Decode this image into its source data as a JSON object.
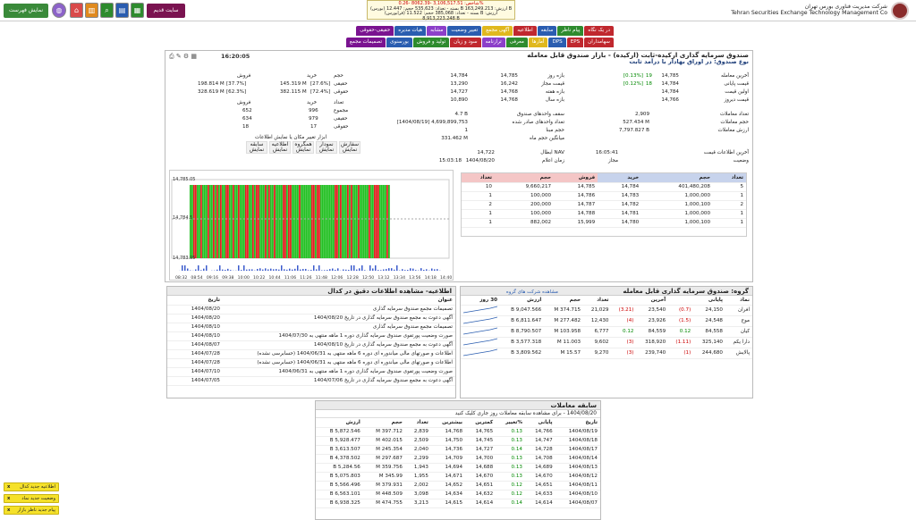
{
  "header": {
    "org_name_fa": "شرکت مدیریت فناوری بورس تهران",
    "org_name_en": "Tehran Securities Exchange Technology Management Co",
    "site_button": "سایت قدیم",
    "notice_button": "نمایش فهرست",
    "ticker": [
      "شاخص: 3,106,517.51 -8062.39 -0.26%",
      "(بورس) بسته - تعداد: 535,623 حجم: 12.447 B ارزش: 163,249.213 B",
      "(فرابورس) بسته - تعداد: 385,068 حجم: 11.522 B ارزش: 8,913,223.248 B"
    ]
  },
  "tabs_row1": [
    "در یک نگاه",
    "پیام ناظر",
    "سابقه",
    "اطلاعیه",
    "آگهی مجمع",
    "تغییر وضعیت",
    "مشابه",
    "هیات مدیره",
    "حقیقی-حقوقی"
  ],
  "tabs_row2": [
    "سهامداران",
    "EPS",
    "DPS",
    "آمارها",
    "معرفی",
    "ترازنامه",
    "سود و زیان",
    "تولید و فروش",
    "بورسنوی",
    "تصمیمات مجمع"
  ],
  "fund": {
    "title": "صندوق سرمایه گذاری ارکیده-ثابت (ارکیده) - بازار صندوق قابل معامله",
    "subtitle": "نوع صندوق: در اوراق بهادار با درآمد ثابت",
    "time": "16:20:05"
  },
  "prices": {
    "last_label": "آخرین معامله",
    "last": "14,785",
    "last_chg": "19",
    "last_pct": "[0.13%]",
    "close_label": "قیمت پایانی",
    "close": "14,784",
    "close_chg": "18",
    "close_pct": "[0.12%]",
    "first_label": "اولین قیمت",
    "first": "14,784",
    "yest_label": "قیمت دیروز",
    "yest": "14,766",
    "count_label": "تعداد معاملات",
    "count": "2,909",
    "vol_label": "حجم معاملات",
    "vol": "527.434 M",
    "value_label": "ارزش معاملات",
    "value": "7,797.827 B",
    "info_label": "آخرین اطلاعات قیمت",
    "info": "16:05:41",
    "status_label": "وضعیت",
    "status": "مجاز"
  },
  "ranges": [
    {
      "label": "بازه روز",
      "a": "14,785",
      "b": "14,784"
    },
    {
      "label": "قیمت مجاز",
      "a": "16,242",
      "b": "13,290"
    },
    {
      "label": "بازه هفته",
      "a": "14,768",
      "b": "14,727"
    },
    {
      "label": "بازه سال",
      "a": "14,768",
      "b": "10,890"
    }
  ],
  "fundinfo": [
    {
      "label": "سقف واحدهای صندوق",
      "v": "4.7 B"
    },
    {
      "label": "تعداد واحدهای صادر شده",
      "v": "[1404/08/19] 4,699,899,753"
    },
    {
      "label": "حجم مبنا",
      "v": "1"
    },
    {
      "label": "میانگین حجم ماه",
      "v": "331.462 M"
    }
  ],
  "nav": {
    "label": "NAV ابطال",
    "v": "14,722",
    "date_label": "زمان اعلام",
    "date": "1404/08/20",
    "time": "15:03:18"
  },
  "legal": {
    "head": [
      "",
      "حجم",
      "خرید",
      "فروش"
    ],
    "rows": [
      {
        "k": "حقیقی",
        "buy": "145.319 M",
        "buy_p": "[27.6%]",
        "sell": "198.814 M",
        "sell_p": "[37.7%]"
      },
      {
        "k": "حقوقی",
        "buy": "382.115 M",
        "buy_p": "[72.4%]",
        "sell": "328.619 M",
        "sell_p": "[62.3%]"
      }
    ],
    "count_head": [
      "تعداد",
      "خرید",
      "فروش"
    ],
    "counts": [
      {
        "k": "مجموع",
        "buy": "996",
        "sell": "652"
      },
      {
        "k": "حقیقی",
        "buy": "979",
        "sell": "634"
      },
      {
        "k": "حقوقی",
        "buy": "17",
        "sell": "18"
      }
    ],
    "tools_label": "ابزار تغییر مکان یا نمایش اطلاعات",
    "tools": [
      [
        "سفارش",
        "نمایش"
      ],
      [
        "نمودار",
        "نمایش"
      ],
      [
        "همگروه",
        "نمایش"
      ],
      [
        "اطلاعیه",
        "نمایش"
      ],
      [
        "سابقه",
        "نمایش"
      ]
    ]
  },
  "orderbook": {
    "head": [
      "تعداد",
      "حجم",
      "خرید",
      "فروش",
      "حجم",
      "تعداد"
    ],
    "rows": [
      [
        "5",
        "401,480,208",
        "14,784",
        "14,785",
        "9,660,217",
        "10"
      ],
      [
        "1",
        "1,000,000",
        "14,783",
        "14,786",
        "100,000",
        "1"
      ],
      [
        "2",
        "1,000,100",
        "14,782",
        "14,787",
        "200,000",
        "2"
      ],
      [
        "1",
        "1,000,000",
        "14,781",
        "14,788",
        "100,000",
        "1"
      ],
      [
        "1",
        "1,000,100",
        "14,780",
        "15,999",
        "882,002",
        "1"
      ]
    ]
  },
  "intraday": {
    "y_labels": [
      "14,785.05",
      "14,784.5",
      "14,783.95"
    ],
    "x_labels": [
      "08:32",
      "08:54",
      "09:16",
      "09:38",
      "10:00",
      "10:22",
      "10:44",
      "11:06",
      "11:26",
      "11:48",
      "12:06",
      "12:28",
      "12:50",
      "13:12",
      "13:34",
      "13:56",
      "14:18",
      "14:40"
    ]
  },
  "news": {
    "title": "اطلاعیه- مشاهده اطلاعات دقیق در کدال",
    "head": [
      "تاریخ",
      "عنوان"
    ],
    "rows": [
      [
        "1404/08/20",
        "تصمیمات مجمع صندوق سرمایه گذاری"
      ],
      [
        "1404/08/20",
        "آگهی دعوت به مجمع صندوق سرمایه گذاری در تاریخ 1404/08/20"
      ],
      [
        "1404/08/10",
        "تصمیمات مجمع صندوق سرمایه گذاری"
      ],
      [
        "1404/08/10",
        "صورت وضعیت پورتفوی صندوق سرمایه گذاری دوره 1 ماهه منتهی به 1404/07/30"
      ],
      [
        "1404/08/07",
        "آگهی دعوت به مجمع صندوق سرمایه گذاری در تاریخ 1404/08/10"
      ],
      [
        "1404/07/28",
        "اطلاعات و صورتهای مالی میاندوره ای دوره 6 ماهه منتهی به 1404/06/31 (حسابرسی نشده)"
      ],
      [
        "1404/07/28",
        "اطلاعات و صورتهای مالی میاندوره ای دوره 6 ماهه منتهی به 1404/06/31 (حسابرسی نشده)"
      ],
      [
        "1404/07/10",
        "صورت وضعیت پورتفوی صندوق سرمایه گذاری دوره 1 ماهه منتهی به 1404/06/31"
      ],
      [
        "1404/07/05",
        "آگهی دعوت به مجمع صندوق سرمایه گذاری در تاریخ 1404/07/06"
      ]
    ]
  },
  "group": {
    "title": "گروه: صندوق سرمایه گذاری قابل معامله",
    "link": "مشاهده شرکت های گروه",
    "head": [
      "نماد",
      "پایانی",
      "",
      "آخرین",
      "",
      "تعداد",
      "حجم",
      "ارزش",
      "30 روز"
    ],
    "rows": [
      [
        "افران",
        "24,150",
        "(0.7)",
        "23,540",
        "(3.21)",
        "21,029",
        "374.715 M",
        "9,047.566 B"
      ],
      [
        "موج",
        "24,548",
        "(1.5)",
        "23,926",
        "(4)",
        "12,430",
        "277.482 M",
        "6,811.647 B"
      ],
      [
        "کیان",
        "84,558",
        "0.12",
        "84,559",
        "0.12",
        "6,777",
        "103.958 M",
        "8,790.507 B"
      ],
      [
        "دارا یکم",
        "325,140",
        "(1.11)",
        "318,920",
        "(3)",
        "9,602",
        "11.003 M",
        "3,577.318 B"
      ],
      [
        "پالایش",
        "244,680",
        "(1)",
        "239,740",
        "(3)",
        "9,270",
        "15.57 M",
        "3,809.562 B"
      ]
    ]
  },
  "history": {
    "title": "سابقه معاملات",
    "subtitle": "1404/08/20 - برای مشاهده سابقه معاملات روز جاری کلیک کنید",
    "head": [
      "تاریخ",
      "پایانی",
      "%تغییر",
      "کمترین",
      "بیشترین",
      "تعداد",
      "حجم",
      "ارزش"
    ],
    "rows": [
      [
        "1404/08/19",
        "14,766",
        "0.13",
        "14,765",
        "14,768",
        "2,839",
        "397.712 M",
        "5,872.546 B"
      ],
      [
        "1404/08/18",
        "14,747",
        "0.13",
        "14,745",
        "14,750",
        "2,509",
        "402.015 M",
        "5,928.477 B"
      ],
      [
        "1404/08/17",
        "14,728",
        "0.14",
        "14,727",
        "14,736",
        "2,040",
        "245.354 M",
        "3,613.507 B"
      ],
      [
        "1404/08/14",
        "14,708",
        "0.13",
        "14,700",
        "14,709",
        "2,299",
        "297.687 M",
        "4,378.502 B"
      ],
      [
        "1404/08/13",
        "14,689",
        "0.13",
        "14,688",
        "14,694",
        "1,943",
        "359.756 M",
        "5,284.56 B"
      ],
      [
        "1404/08/12",
        "14,670",
        "0.13",
        "14,670",
        "14,671",
        "1,955",
        "345.99 M",
        "5,075.803 B"
      ],
      [
        "1404/08/11",
        "14,651",
        "0.12",
        "14,651",
        "14,652",
        "2,002",
        "379.931 M",
        "5,566.496 B"
      ],
      [
        "1404/08/10",
        "14,633",
        "0.12",
        "14,632",
        "14,634",
        "3,098",
        "448.509 M",
        "6,563.101 B"
      ],
      [
        "1404/08/07",
        "14,614",
        "0.14",
        "14,614",
        "14,615",
        "3,213",
        "474.755 M",
        "6,938.325 B"
      ]
    ]
  },
  "notifs": [
    "اطلاعیه جدید کدال",
    "وضعیت جدید نماد",
    "پیام جدید ناظر بازار"
  ],
  "colors": {
    "tab_green": "#2e8b2e",
    "tab_red": "#c0282e",
    "tab_blue": "#2a5db0",
    "buy": "#c7d3ec",
    "sell": "#f4c6c6"
  }
}
